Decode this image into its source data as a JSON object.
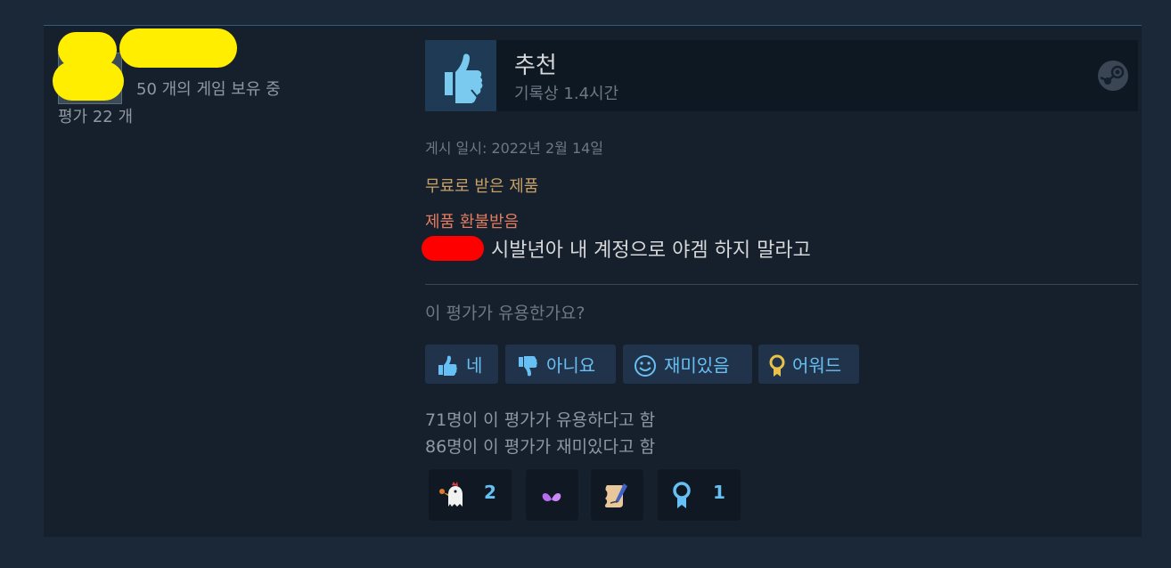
{
  "author": {
    "games_owned": "50 개의 게임 보유 중",
    "reviews_count": "평가 22 개"
  },
  "review": {
    "verdict": "추천",
    "hours": "기록상 1.4시간",
    "posted": "게시 일시: 2022년 2월 14일",
    "free_product": "무료로 받은 제품",
    "refunded": "제품 환불받음",
    "text": "시발년아 내 계정으로 야겜 하지 말라고"
  },
  "feedback": {
    "question": "이 평가가 유용한가요?",
    "buttons": [
      {
        "label": "네",
        "icon": "thumbs-up-icon"
      },
      {
        "label": "아니요",
        "icon": "thumbs-down-icon"
      },
      {
        "label": "재미있음",
        "icon": "smiley-icon"
      },
      {
        "label": "어워드",
        "icon": "award-ribbon-icon"
      }
    ],
    "helpful_count": "71명이 이 평가가 유용하다고 함",
    "funny_count": "86명이 이 평가가 재미있다고 함"
  },
  "awards": [
    {
      "icon": "chicken-award-icon",
      "count": "2"
    },
    {
      "icon": "purple-wings-award-icon",
      "count": ""
    },
    {
      "icon": "scroll-quill-award-icon",
      "count": ""
    },
    {
      "icon": "ribbon-award-icon",
      "count": "1"
    }
  ],
  "colors": {
    "background": "#1b2838",
    "card": "#16202d",
    "accent_blue": "#66c0f4",
    "free_product": "#c7a167",
    "refunded": "#e27b60",
    "redaction_yellow": "#ffee00",
    "redaction_red": "#ff0000"
  }
}
